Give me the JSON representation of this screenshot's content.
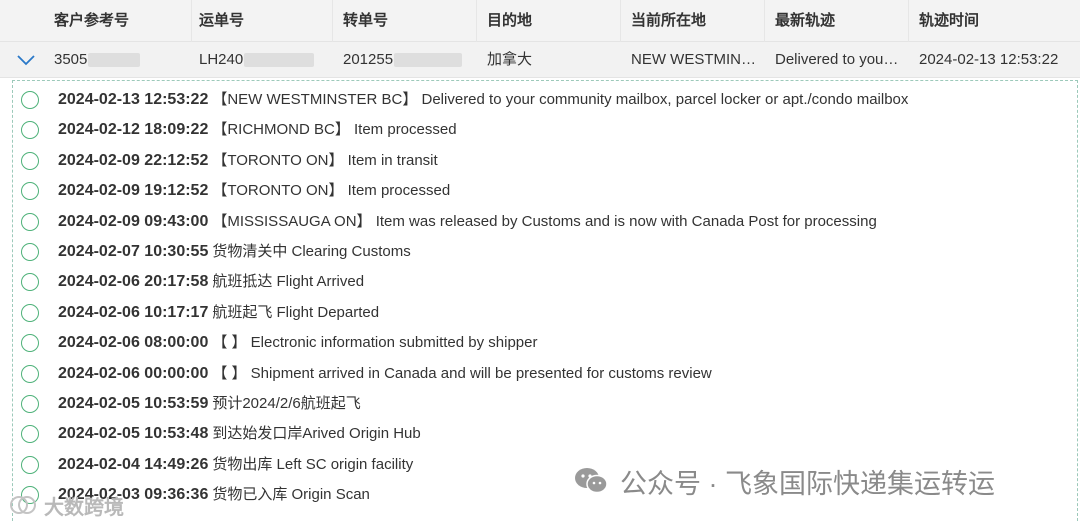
{
  "columns": [
    {
      "label": "客户参考号"
    },
    {
      "label": "运单号"
    },
    {
      "label": "转单号"
    },
    {
      "label": "目的地"
    },
    {
      "label": "当前所在地"
    },
    {
      "label": "最新轨迹"
    },
    {
      "label": "轨迹时间"
    }
  ],
  "row": {
    "customer_ref": "3505",
    "waybill": "LH240",
    "transfer_no": "201255",
    "destination": "加拿大",
    "current_location": "NEW WESTMINSTER BC",
    "latest_track": "Delivered to your community mailbox, parcel locker or apt./condo mailbox",
    "track_time": "2024-02-13 12:53:22"
  },
  "events": [
    {
      "time": "2024-02-13 12:53:22",
      "desc": "【NEW WESTMINSTER BC】 Delivered to your community mailbox, parcel locker or apt./condo mailbox"
    },
    {
      "time": "2024-02-12 18:09:22",
      "desc": "【RICHMOND BC】 Item processed"
    },
    {
      "time": "2024-02-09 22:12:52",
      "desc": "【TORONTO ON】 Item in transit"
    },
    {
      "time": "2024-02-09 19:12:52",
      "desc": "【TORONTO ON】 Item processed"
    },
    {
      "time": "2024-02-09 09:43:00",
      "desc": "【MISSISSAUGA ON】 Item was released by Customs and is now with Canada Post for processing"
    },
    {
      "time": "2024-02-07 10:30:55",
      "desc": "货物清关中 Clearing Customs"
    },
    {
      "time": "2024-02-06 20:17:58",
      "desc": "航班抵达 Flight Arrived"
    },
    {
      "time": "2024-02-06 10:17:17",
      "desc": "航班起飞 Flight Departed"
    },
    {
      "time": "2024-02-06 08:00:00",
      "desc": "【 】 Electronic information submitted by shipper"
    },
    {
      "time": "2024-02-06 00:00:00",
      "desc": "【 】 Shipment arrived in Canada and will be presented for customs review"
    },
    {
      "time": "2024-02-05 10:53:59",
      "desc": "预计2024/2/6航班起飞"
    },
    {
      "time": "2024-02-05 10:53:48",
      "desc": "到达始发口岸Arived Origin Hub"
    },
    {
      "time": "2024-02-04 14:49:26",
      "desc": "货物出库 Left SC origin facility"
    },
    {
      "time": "2024-02-03 09:36:36",
      "desc": "货物已入库 Origin Scan"
    }
  ],
  "watermark": {
    "main": "公众号 · 飞象国际快递集运转运",
    "corner": "大数跨境"
  },
  "colors": {
    "accent": "#4fb27a",
    "header_bg": "#f3f3f3",
    "panel_border": "#9cc9ba"
  }
}
